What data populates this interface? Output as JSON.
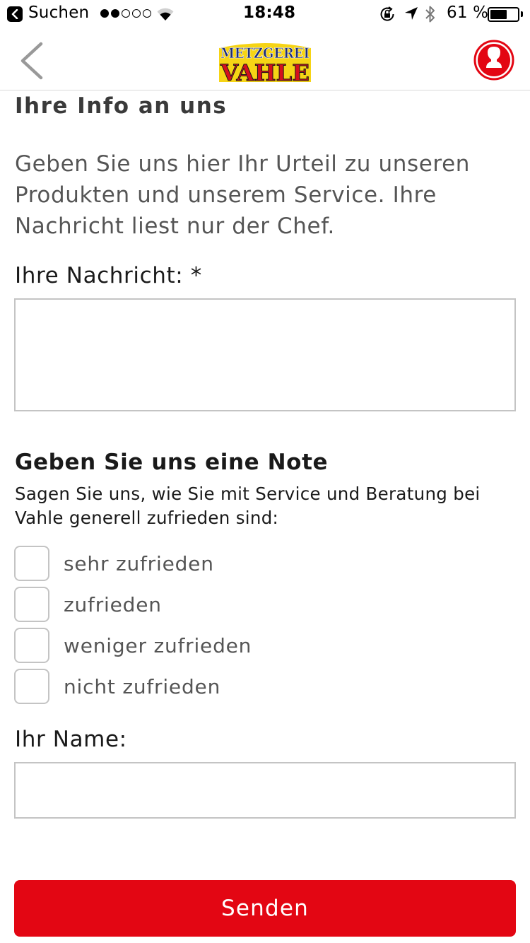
{
  "status_bar": {
    "back_app": "Suchen",
    "time": "18:48",
    "battery": "61 %",
    "battery_level": 0.61,
    "signal_strength": 2,
    "signal_max": 5
  },
  "nav": {
    "back_icon": "chevron-left-icon",
    "logo_line1": "METZGEREI",
    "logo_line2": "VAHLE",
    "profile_icon": "user-avatar-icon"
  },
  "form": {
    "title": "Ihre Info an uns",
    "intro": "Geben Sie uns hier Ihr Urteil zu unseren Produkten und unserem Service. Ihre Nachricht liest nur der Chef.",
    "message_label": "Ihre Nachricht: *",
    "message_value": "",
    "rating_title": "Geben Sie uns eine Note",
    "rating_description": "Sagen Sie uns, wie Sie mit Service und Beratung bei Vahle generell zufrieden sind:",
    "rating_options": [
      {
        "label": "sehr zufrieden",
        "checked": false
      },
      {
        "label": "zufrieden",
        "checked": false
      },
      {
        "label": "weniger zufrieden",
        "checked": false
      },
      {
        "label": "nicht zufrieden",
        "checked": false
      }
    ],
    "name_label": "Ihr Name:",
    "name_value": "",
    "submit_label": "Senden"
  },
  "colors": {
    "accent": "#e30613",
    "logo_yellow": "#f6d415",
    "border": "#c4c4c4"
  }
}
